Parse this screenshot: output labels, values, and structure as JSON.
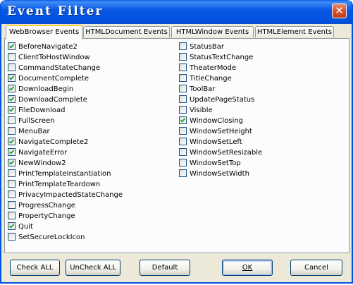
{
  "window": {
    "title": "Event Filter",
    "close_glyph": "✕"
  },
  "tabs": [
    {
      "label": "WebBrowser Events",
      "active": true
    },
    {
      "label": "HTMLDocument Events",
      "active": false
    },
    {
      "label": "HTMLWindow Events",
      "active": false
    },
    {
      "label": "HTMLElement Events",
      "active": false
    }
  ],
  "events_left": [
    {
      "label": "BeforeNavigate2",
      "checked": true
    },
    {
      "label": "ClientToHostWindow",
      "checked": false
    },
    {
      "label": "CommandStateChange",
      "checked": false
    },
    {
      "label": "DocumentComplete",
      "checked": true
    },
    {
      "label": "DownloadBegin",
      "checked": true
    },
    {
      "label": "DownloadComplete",
      "checked": true
    },
    {
      "label": "FileDownload",
      "checked": true
    },
    {
      "label": "FullScreen",
      "checked": false
    },
    {
      "label": "MenuBar",
      "checked": false
    },
    {
      "label": "NavigateComplete2",
      "checked": true
    },
    {
      "label": "NavigateError",
      "checked": true
    },
    {
      "label": "NewWindow2",
      "checked": true
    },
    {
      "label": "PrintTemplateInstantiation",
      "checked": false
    },
    {
      "label": "PrintTemplateTeardown",
      "checked": false
    },
    {
      "label": "PrivacyImpactedStateChange",
      "checked": false
    },
    {
      "label": "ProgressChange",
      "checked": false
    },
    {
      "label": "PropertyChange",
      "checked": false
    },
    {
      "label": "Quit",
      "checked": true
    },
    {
      "label": "SetSecureLockIcon",
      "checked": false
    }
  ],
  "events_right": [
    {
      "label": "StatusBar",
      "checked": false
    },
    {
      "label": "StatusTextChange",
      "checked": false
    },
    {
      "label": "TheaterMode",
      "checked": false
    },
    {
      "label": "TitleChange",
      "checked": false
    },
    {
      "label": "ToolBar",
      "checked": false
    },
    {
      "label": "UpdatePageStatus",
      "checked": false
    },
    {
      "label": "Visible",
      "checked": false
    },
    {
      "label": "WindowClosing",
      "checked": true
    },
    {
      "label": "WindowSetHeight",
      "checked": false
    },
    {
      "label": "WindowSetLeft",
      "checked": false
    },
    {
      "label": "WindowSetResizable",
      "checked": false
    },
    {
      "label": "WindowSetTop",
      "checked": false
    },
    {
      "label": "WindowSetWidth",
      "checked": false
    }
  ],
  "buttons": {
    "check_all": "Check ALL",
    "uncheck_all": "UnCheck ALL",
    "default": "Default",
    "ok": "OK",
    "cancel": "Cancel"
  },
  "colors": {
    "titlebar": "#0054e3",
    "dialog_bg": "#ece9d8",
    "check_mark": "#21a121",
    "tab_highlight": "#ffc83c"
  }
}
